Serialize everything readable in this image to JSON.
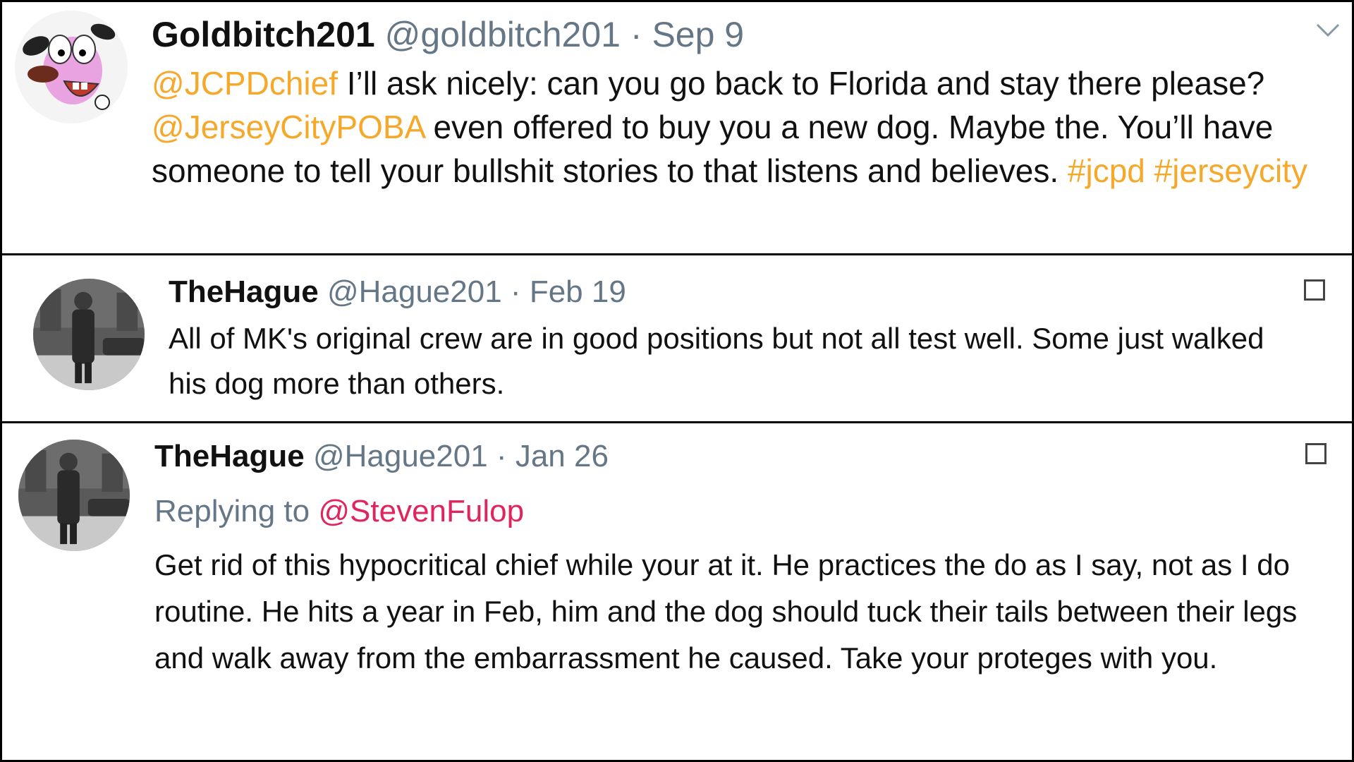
{
  "tweets": [
    {
      "name": "Goldbitch201",
      "handle": "@goldbitch201",
      "separator": "·",
      "date": "Sep 9",
      "avatar_icon": "cartoon-dog-avatar",
      "menu_icon": "chevron-down-icon",
      "body": {
        "mention1": "@JCPDchief",
        "text1": " I’ll ask nicely: can you go back to Florida and stay there please? ",
        "mention2": "@JerseyCityPOBA",
        "text2": " even offered to buy you a new dog. Maybe the. You’ll have someone to tell your bullshit stories to that listens and believes. ",
        "hashtag1": "#jcpd",
        "space": " ",
        "hashtag2": "#jerseycity"
      }
    },
    {
      "name": "TheHague",
      "handle": "@Hague201",
      "separator": "·",
      "date": "Feb 19",
      "avatar_icon": "vintage-photo-avatar",
      "menu_icon": "checkbox-icon",
      "body": "All of MK's original crew are in good positions but not all test well.  Some just walked his dog more than others."
    },
    {
      "name": "TheHague",
      "handle": "@Hague201",
      "separator": "·",
      "date": "Jan 26",
      "avatar_icon": "vintage-photo-avatar",
      "menu_icon": "checkbox-icon",
      "reply_label": "Replying to",
      "reply_to": "@StevenFulop",
      "body": "Get rid of this hypocritical chief while your at it.  He practices the do as I say, not as I do routine. He hits a year in Feb, him and the dog should tuck their tails between their legs and walk away from the embarrassment he caused. Take your proteges with you."
    }
  ],
  "colors": {
    "mention": "#f5a82a",
    "reply_link": "#e0245e",
    "meta": "#657786"
  }
}
